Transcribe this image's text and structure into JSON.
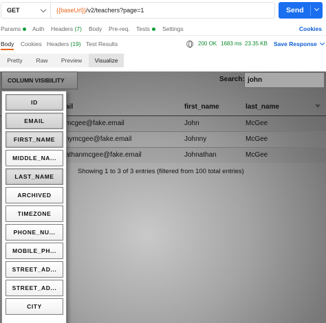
{
  "request": {
    "method": "GET",
    "url_var": "{{baseUrl}}",
    "url_path": "/v2/teachers?page=1",
    "send_label": "Send",
    "accent_color": "#e8641c",
    "send_color": "#1a6ff0"
  },
  "request_tabs": {
    "params": "Params",
    "auth": "Auth",
    "headers": "Headers",
    "headers_count": "(7)",
    "body": "Body",
    "prereq": "Pre-req.",
    "tests": "Tests",
    "settings": "Settings",
    "cookies": "Cookies"
  },
  "response_tabs": {
    "body": "Body",
    "cookies": "Cookies",
    "headers": "Headers",
    "headers_count": "(19)",
    "test_results": "Test Results",
    "status": "200 OK",
    "time": "1683 ms",
    "size": "23.35 KB",
    "save_response": "Save Response"
  },
  "view_modes": {
    "pretty": "Pretty",
    "raw": "Raw",
    "preview": "Preview",
    "visualize": "Visualize"
  },
  "visualizer": {
    "column_visibility_label": "COLUMN VISIBILITY",
    "search_label": "Search:",
    "search_value": "john",
    "columns": {
      "email": "ail",
      "first_name": "first_name",
      "last_name": "last_name"
    },
    "rows": [
      {
        "email": "mcgee@fake.email",
        "first_name": "John",
        "last_name": "McGee"
      },
      {
        "email": "nymcgee@fake.email",
        "first_name": "Johnny",
        "last_name": "McGee"
      },
      {
        "email": "athanmcgee@fake.email",
        "first_name": "Johnathan",
        "last_name": "McGee"
      }
    ],
    "info": "Showing 1 to 3 of 3 entries (filtered from 100 total entries)",
    "visibility_buttons": [
      {
        "label": "ID",
        "active": true
      },
      {
        "label": "EMAIL",
        "active": true
      },
      {
        "label": "FIRST_NAME",
        "active": true
      },
      {
        "label": "MIDDLE_NA...",
        "active": false
      },
      {
        "label": "LAST_NAME",
        "active": true
      },
      {
        "label": "ARCHIVED",
        "active": false
      },
      {
        "label": "TIMEZONE",
        "active": false
      },
      {
        "label": "PHONE_NU...",
        "active": false
      },
      {
        "label": "MOBILE_PH...",
        "active": false
      },
      {
        "label": "STREET_AD...",
        "active": false
      },
      {
        "label": "STREET_AD...",
        "active": false
      },
      {
        "label": "CITY",
        "active": false
      }
    ]
  }
}
